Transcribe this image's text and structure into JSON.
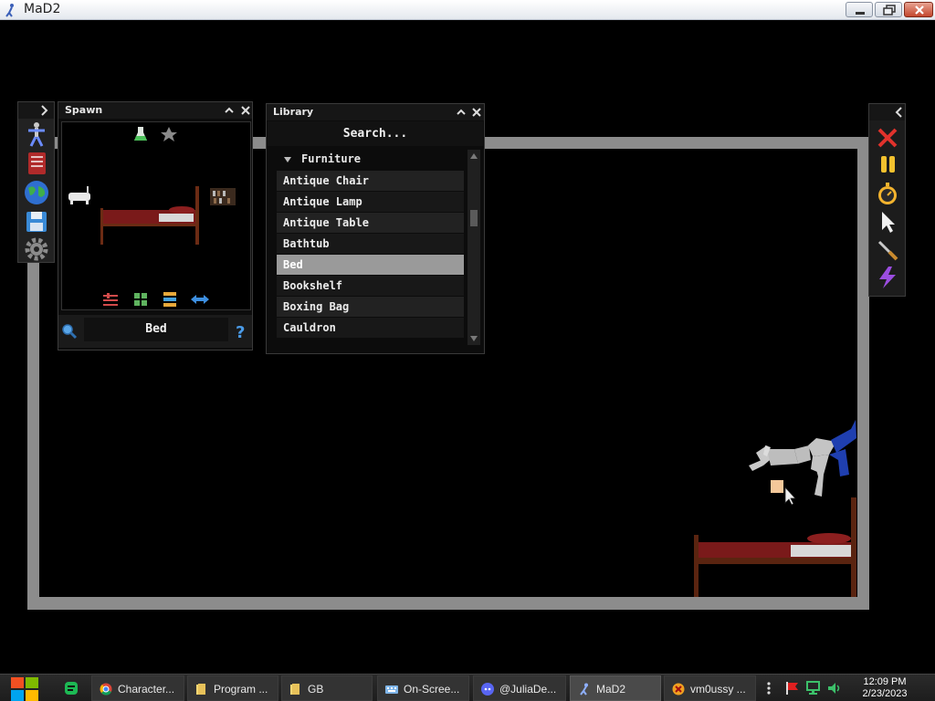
{
  "window": {
    "title": "MaD2"
  },
  "spawn": {
    "title": "Spawn",
    "selected_name": "Bed"
  },
  "library": {
    "title": "Library",
    "search_placeholder": "Search...",
    "category": "Furniture",
    "items": [
      "Antique Chair",
      "Antique Lamp",
      "Antique Table",
      "Bathtub",
      "Bed",
      "Bookshelf",
      "Boxing Bag",
      "Cauldron"
    ],
    "selected": "Bed"
  },
  "left_toolbar": {
    "icons": [
      "ragdoll-icon",
      "book-icon",
      "globe-icon",
      "save-icon",
      "settings-gear-icon"
    ]
  },
  "right_toolbar": {
    "icons": [
      "close-x-icon",
      "pause-icon",
      "stopwatch-icon",
      "cursor-icon",
      "knife-icon",
      "lightning-icon"
    ]
  },
  "taskbar": {
    "items": [
      {
        "label": "Character...",
        "icon": "chrome-icon"
      },
      {
        "label": "Program ...",
        "icon": "folder-icon"
      },
      {
        "label": "GB",
        "icon": "folder-icon"
      },
      {
        "label": "On-Scree...",
        "icon": "keyboard-icon"
      },
      {
        "label": "@JuliaDe...",
        "icon": "discord-icon"
      },
      {
        "label": "MaD2",
        "icon": "mad2-icon"
      },
      {
        "label": "vm0ussy ...",
        "icon": "vm-icon"
      }
    ],
    "clock_time": "12:09 PM",
    "clock_date": "2/23/2023"
  },
  "colors": {
    "arena_border": "#8c8c8c",
    "selection": "#9a9a9a",
    "panel_bg": "#0c0c0c"
  }
}
